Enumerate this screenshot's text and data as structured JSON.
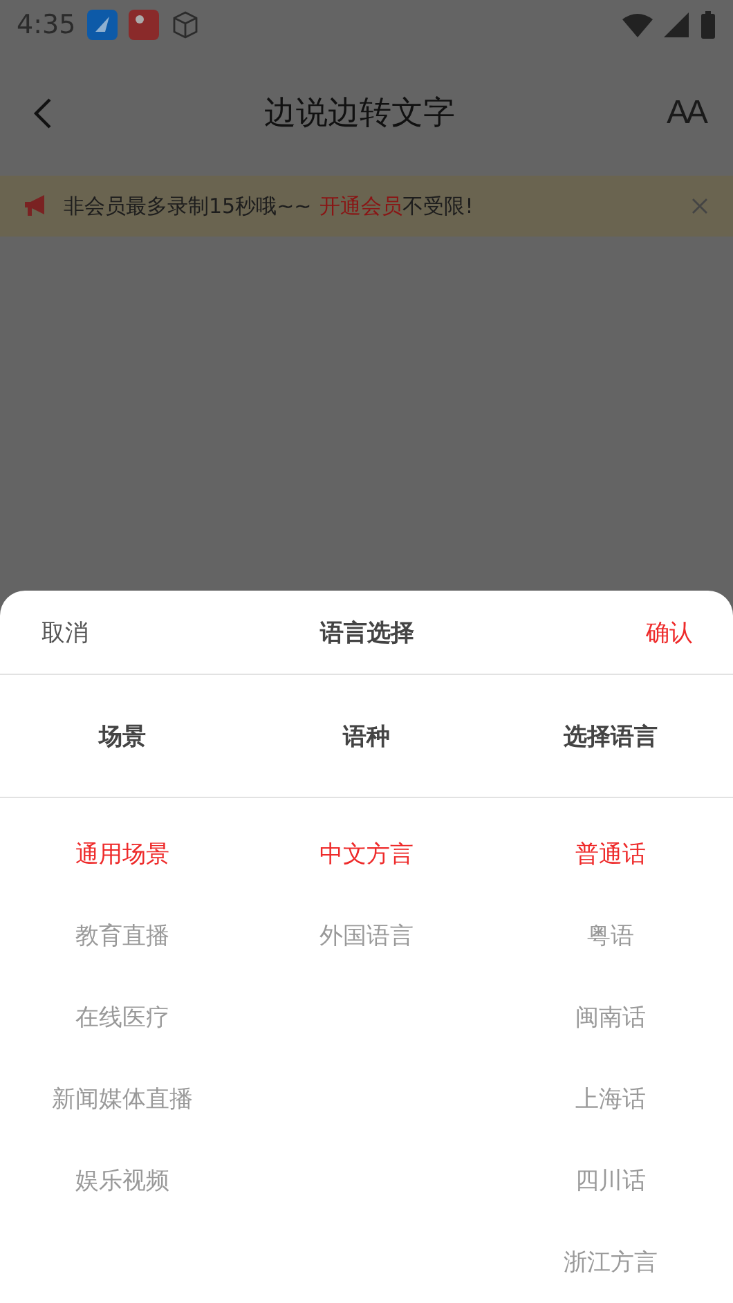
{
  "status_bar": {
    "time": "4:35"
  },
  "header": {
    "title": "边说边转文字",
    "font_button": "AA"
  },
  "banner": {
    "text": "非会员最多录制15秒哦~~",
    "link": "开通会员",
    "suffix": "不受限!"
  },
  "sheet": {
    "cancel": "取消",
    "title": "语言选择",
    "confirm": "确认",
    "columns": [
      {
        "heading": "场景",
        "items": [
          {
            "label": "通用场景",
            "selected": true
          },
          {
            "label": "教育直播",
            "selected": false
          },
          {
            "label": "在线医疗",
            "selected": false
          },
          {
            "label": "新闻媒体直播",
            "selected": false
          },
          {
            "label": "娱乐视频",
            "selected": false
          }
        ]
      },
      {
        "heading": "语种",
        "items": [
          {
            "label": "中文方言",
            "selected": true
          },
          {
            "label": "外国语言",
            "selected": false
          }
        ]
      },
      {
        "heading": "选择语言",
        "items": [
          {
            "label": "普通话",
            "selected": true
          },
          {
            "label": "粤语",
            "selected": false
          },
          {
            "label": "闽南话",
            "selected": false
          },
          {
            "label": "上海话",
            "selected": false
          },
          {
            "label": "四川话",
            "selected": false
          },
          {
            "label": "浙江方言",
            "selected": false
          }
        ]
      }
    ]
  }
}
